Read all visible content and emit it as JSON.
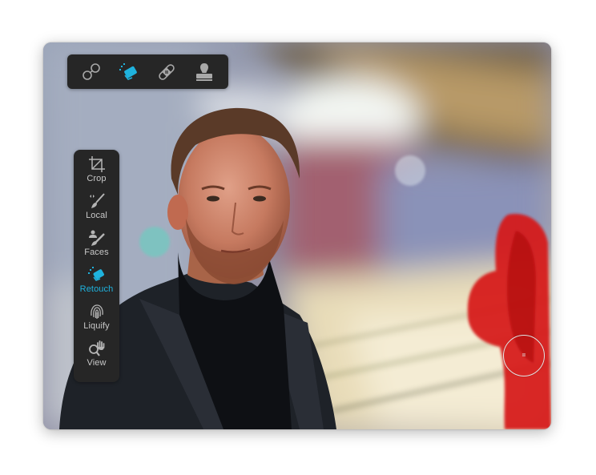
{
  "app": {
    "accent_color": "#1fb2dd",
    "panel_color": "#262626",
    "mask_color": "#d61418"
  },
  "toolbar": {
    "items": [
      {
        "name": "heal-clone-link",
        "icon": "link-circles-icon",
        "active": false
      },
      {
        "name": "erase",
        "icon": "eraser-icon",
        "active": true
      },
      {
        "name": "heal",
        "icon": "bandage-icon",
        "active": false
      },
      {
        "name": "clone",
        "icon": "stamp-icon",
        "active": false
      }
    ]
  },
  "sidebar": {
    "items": [
      {
        "label": "Crop",
        "icon": "crop-icon",
        "active": false
      },
      {
        "label": "Local",
        "icon": "brush-icon",
        "active": false
      },
      {
        "label": "Faces",
        "icon": "face-brush-icon",
        "active": false
      },
      {
        "label": "Retouch",
        "icon": "eraser-icon",
        "active": true
      },
      {
        "label": "Liquify",
        "icon": "fingerprint-icon",
        "active": false
      },
      {
        "label": "View",
        "icon": "zoom-hand-icon",
        "active": false
      }
    ]
  },
  "canvas": {
    "brush_mode_symbol": "="
  }
}
